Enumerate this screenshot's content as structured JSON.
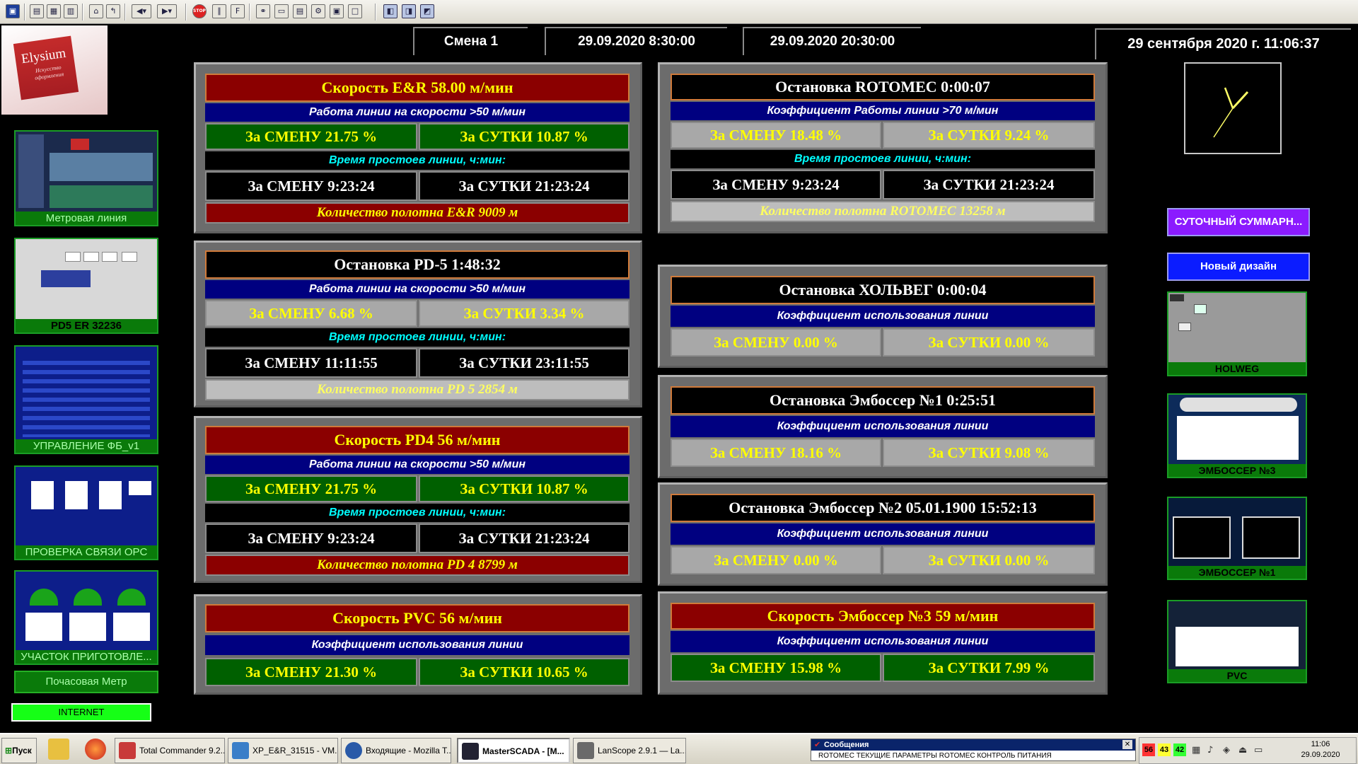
{
  "header": {
    "shift": "Смена 1",
    "shift_start": "29.09.2020 8:30:00",
    "shift_end": "29.09.2020 20:30:00",
    "current_datetime": "29 сентября 2020 г. 11:06:37"
  },
  "logo": {
    "name": "Elysium",
    "tagline": "Искусство оформления"
  },
  "left_nav": [
    {
      "label": "Метровая линия"
    },
    {
      "label": "PD5 ER 32236"
    },
    {
      "label": "УПРАВЛЕНИЕ ФБ_v1"
    },
    {
      "label": "ПРОВЕРКА СВЯЗИ OPC"
    },
    {
      "label": "УЧАСТОК ПРИГОТОВЛЕ..."
    },
    {
      "label": "Почасовая Метр"
    },
    {
      "label": "INTERNET"
    }
  ],
  "panels": {
    "er": {
      "title": "Скорость E&R    58.00 м/мин",
      "subtitle": "Работа линии на скорости >50 м/мин",
      "shift_pct": "За СМЕНУ    21.75 %",
      "day_pct": "За СУТКИ    10.87 %",
      "downtime_label": "Время простоев линии, ч:мин:",
      "shift_down": "За СМЕНУ   9:23:24",
      "day_down": "За СУТКИ   21:23:24",
      "quantity": "Количество полотна E&R         9009 м"
    },
    "pd5": {
      "title": "Остановка PD-5   1:48:32",
      "subtitle": "Работа линии на скорости >50 м/мин",
      "shift_pct": "За СМЕНУ     6.68 %",
      "day_pct": "За СУТКИ     3.34 %",
      "downtime_label": "Время простоев линии, ч:мин:",
      "shift_down": "За СМЕНУ   11:11:55",
      "day_down": "За СУТКИ   23:11:55",
      "quantity": "Количество полотна PD 5         2854 м"
    },
    "pd4": {
      "title": "Скорость PD4    56 м/мин",
      "subtitle": "Работа линии на скорости >50 м/мин",
      "shift_pct": "За СМЕНУ    21.75 %",
      "day_pct": "За СУТКИ    10.87 %",
      "downtime_label": "Время простоев линии, ч:мин:",
      "shift_down": "За СМЕНУ   9:23:24",
      "day_down": "За СУТКИ   21:23:24",
      "quantity": "Количество полотна PD 4         8799 м"
    },
    "pvc": {
      "title": "Скорость PVC    56 м/мин",
      "subtitle": "Коэффициент использования линии",
      "shift_pct": "За СМЕНУ    21.30 %",
      "day_pct": "За СУТКИ    10.65 %"
    },
    "rotomec": {
      "title": "Остановка ROTOMEC   0:00:07",
      "subtitle": "Коэффициент Работы линии >70 м/мин",
      "shift_pct": "За СМЕНУ    18.48 %",
      "day_pct": "За СУТКИ     9.24 %",
      "downtime_label": "Время простоев линии, ч:мин:",
      "shift_down": "За СМЕНУ   9:23:24",
      "day_down": "За СУТКИ   21:23:24",
      "quantity": "Количество полотна ROTOMEC        13258 м"
    },
    "holweg": {
      "title": "Остановка ХОЛЬВЕГ   0:00:04",
      "subtitle": "Коэффициент использования линии",
      "shift_pct": "За СМЕНУ     0.00 %",
      "day_pct": "За СУТКИ     0.00 %"
    },
    "emb1": {
      "title": "Остановка Эмбоссер №1   0:25:51",
      "subtitle": "Коэффициент использования линии",
      "shift_pct": "За СМЕНУ    18.16 %",
      "day_pct": "За СУТКИ     9.08 %"
    },
    "emb2": {
      "title": "Остановка Эмбоссер №2  05.01.1900 15:52:13",
      "subtitle": "Коэффициент использования линии",
      "shift_pct": "За СМЕНУ     0.00 %",
      "day_pct": "За СУТКИ     0.00 %"
    },
    "emb3": {
      "title": "Скорость Эмбоссер №3    59 м/мин",
      "subtitle": "Коэффициент использования линии",
      "shift_pct": "За СМЕНУ    15.98 %",
      "day_pct": "За СУТКИ     7.99 %"
    }
  },
  "right_nav": {
    "daily_summary": "СУТОЧНЫЙ СУММАРН...",
    "new_design": "Новый дизайн",
    "thumbs": [
      {
        "label": "HOLWEG"
      },
      {
        "label": "ЭМБОССЕР №3"
      },
      {
        "label": "ЭМБОССЕР №1"
      },
      {
        "label": "PVC"
      }
    ]
  },
  "taskbar": {
    "start": "Пуск",
    "tasks": [
      {
        "label": "Total Commander 9.2..."
      },
      {
        "label": "XP_E&R_31515 - VM..."
      },
      {
        "label": "Входящие - Mozilla T..."
      },
      {
        "label": "MasterSCADA - [M..."
      },
      {
        "label": "LanScope 2.9.1 — La..."
      }
    ],
    "messages_title": "Сообщения",
    "messages_text": "ROTOMEC ТЕКУЩИЕ ПАРАМЕТРЫ ROTOMEC КОНТРОЛЬ ПИТАНИЯ",
    "tray_counts": [
      "56",
      "43",
      "42"
    ],
    "clock_time": "11:06",
    "clock_date": "29.09.2020"
  },
  "colors": {
    "title_red": "#8b0000",
    "value_yellow": "#ffff00",
    "sub_blue": "#000080",
    "cell_green": "#006000",
    "cell_gray": "#a8a8a8",
    "downtime_cyan": "#00ffff",
    "nav_green": "#0a7a0a",
    "button_purple": "#8b1bff",
    "button_blue": "#0b1cff",
    "internet_green": "#16ff16"
  }
}
